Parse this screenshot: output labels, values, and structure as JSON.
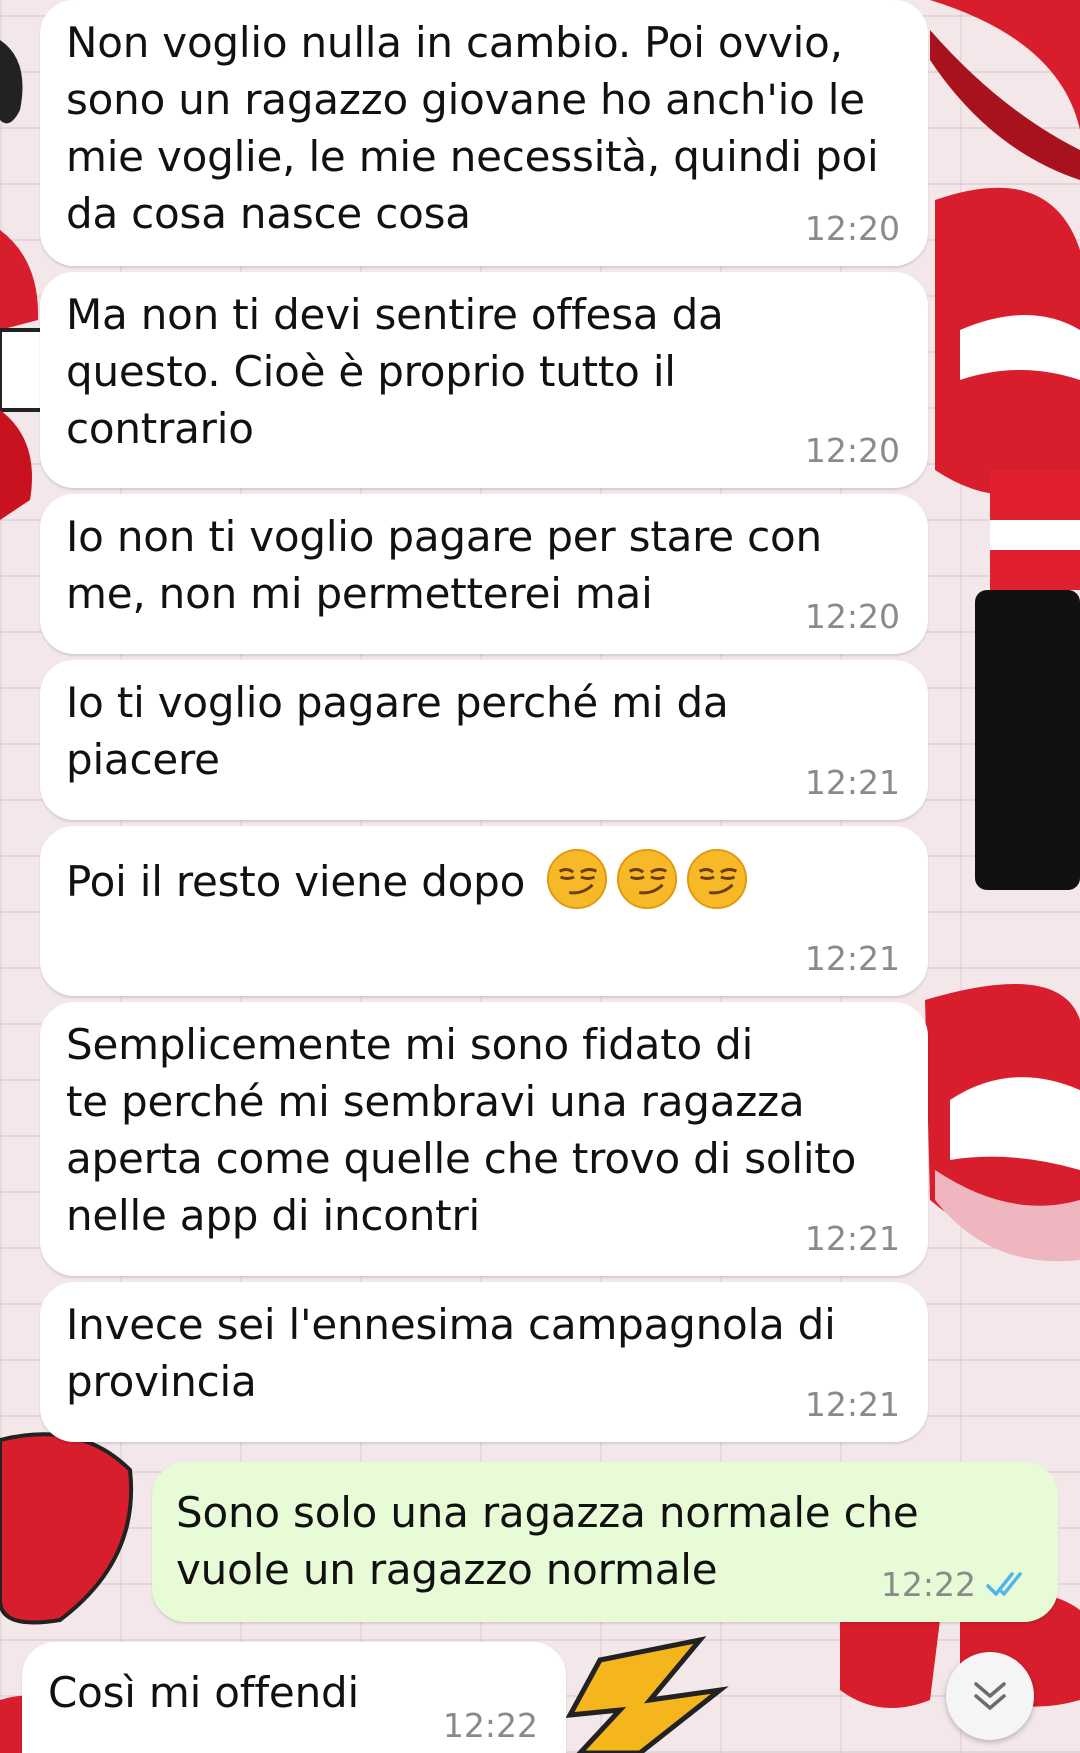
{
  "chat": {
    "messages": [
      {
        "direction": "incoming",
        "text": "Non voglio nulla in cambio. Poi ovvio,\nsono un ragazzo giovane ho anch'io le\nmie voglie, le mie necessità, quindi poi\nda cosa nasce cosa",
        "time": "12:20"
      },
      {
        "direction": "incoming",
        "text": "Ma non ti devi sentire offesa da\nquesto. Cioè è proprio tutto il\ncontrario",
        "time": "12:20"
      },
      {
        "direction": "incoming",
        "text": "Io non ti voglio pagare per stare con\nme, non mi permetterei mai",
        "time": "12:20"
      },
      {
        "direction": "incoming",
        "text": "Io ti voglio pagare perché mi da\npiacere",
        "time": "12:21"
      },
      {
        "direction": "incoming",
        "text": "Poi il resto viene dopo",
        "emojis": [
          "smirking-face",
          "smirking-face",
          "smirking-face"
        ],
        "time": "12:21"
      },
      {
        "direction": "incoming",
        "text": "Semplicemente mi sono fidato di\nte perché mi sembravi una ragazza\naperta come quelle che trovo di solito\nnelle app di incontri",
        "time": "12:21"
      },
      {
        "direction": "incoming",
        "text": "Invece sei l'ennesima campagnola di\nprovincia",
        "time": "12:21"
      },
      {
        "direction": "outgoing",
        "text": "Sono solo una ragazza normale che\nvuole un ragazzo normale",
        "time": "12:22",
        "status": "read"
      },
      {
        "direction": "incoming",
        "text": "Così mi offendi",
        "time": "12:22"
      }
    ],
    "scroll_button_icon": "chevron-double-down-icon",
    "read_tick_icon": "double-check-icon"
  },
  "colors": {
    "incoming_bubble": "#ffffff",
    "outgoing_bubble": "#e7fcd6",
    "timestamp": "#8a8a8a",
    "read_ticks": "#4fb6ec",
    "wallpaper_lips": "#d81e2c"
  }
}
